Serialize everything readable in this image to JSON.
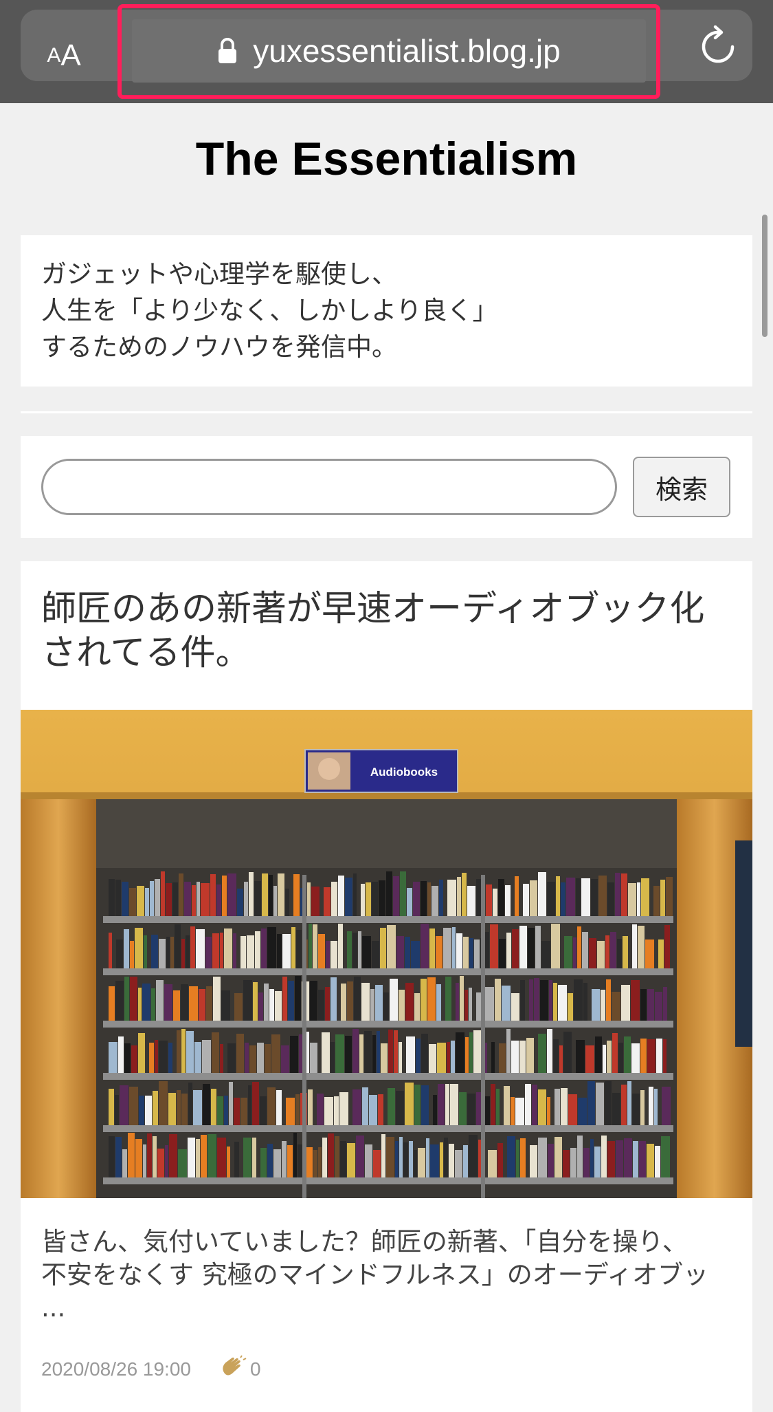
{
  "browser": {
    "text_size_small": "A",
    "text_size_large": "A",
    "url": "yuxessentialist.blog.jp",
    "highlight_color": "#ff1e5a"
  },
  "site": {
    "title": "The Essentialism",
    "description_lines": [
      "ガジェットや心理学を駆使し、",
      "人生を「より少なく、しかしより良く」",
      "するためのノウハウを発信中。"
    ]
  },
  "search": {
    "value": "",
    "placeholder": "",
    "button_label": "検索"
  },
  "article": {
    "title": "師匠のあの新著が早速オーディオブック化されてる件。",
    "image_sign_text": "Audiobooks",
    "image_description": "audiobooks-shelf-photo",
    "excerpt": "皆さん、気付いていました？師匠の新著、「自分を操り、不安をなくす 究極のマインドフルネス」のオーディオブッ ...",
    "date": "2020/08/26 19:00",
    "clap_count": "0"
  }
}
